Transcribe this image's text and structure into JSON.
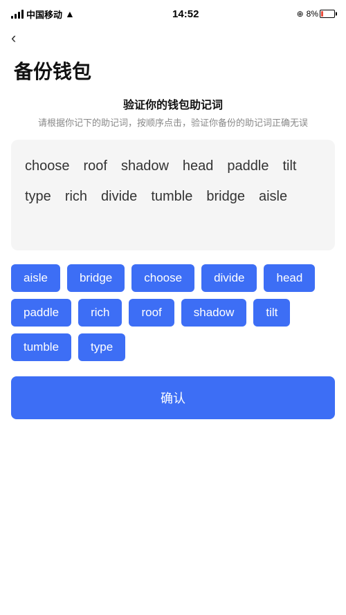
{
  "statusBar": {
    "carrier": "中国移动",
    "time": "14:52",
    "batteryPercent": "8%"
  },
  "nav": {
    "backLabel": "‹"
  },
  "page": {
    "title": "备份钱包"
  },
  "verifySection": {
    "heading": "验证你的钱包助记词",
    "description": "请根据你记下的助记词，按顺序点击，验证你备份的助记词正确无误"
  },
  "displayWords": [
    "choose",
    "roof",
    "shadow",
    "head",
    "paddle",
    "tilt",
    "type",
    "rich",
    "divide",
    "tumble",
    "bridge",
    "aisle"
  ],
  "chips": [
    "aisle",
    "bridge",
    "choose",
    "divide",
    "head",
    "paddle",
    "rich",
    "roof",
    "shadow",
    "tilt",
    "tumble",
    "type"
  ],
  "confirmButton": {
    "label": "确认"
  }
}
